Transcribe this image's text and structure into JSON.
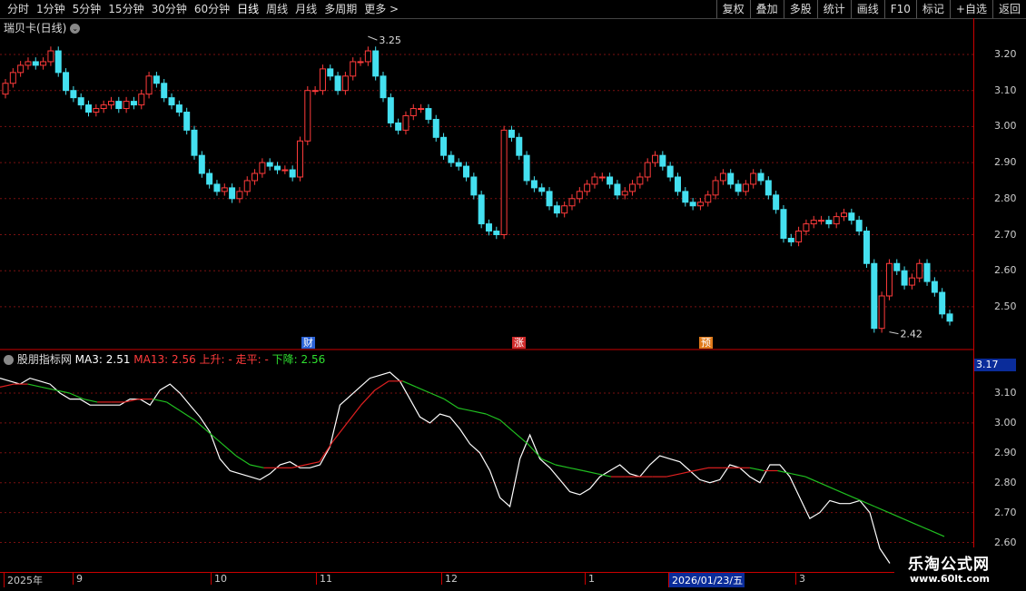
{
  "toolbar": {
    "periods": [
      "分时",
      "1分钟",
      "5分钟",
      "15分钟",
      "30分钟",
      "60分钟",
      "日线",
      "周线",
      "月线",
      "多周期",
      "更多"
    ],
    "active_period": "日线",
    "buttons": [
      "复权",
      "叠加",
      "多股",
      "统计",
      "画线",
      "F10",
      "标记",
      "+自选",
      "返回"
    ]
  },
  "chart_title": "瑞贝卡(日线)",
  "price_axis": {
    "ticks": [
      "3.20",
      "3.10",
      "3.00",
      "2.90",
      "2.80",
      "2.70",
      "2.60",
      "2.50"
    ],
    "range": [
      2.42,
      3.25
    ]
  },
  "annotations": {
    "high": "3.25",
    "low": "2.42"
  },
  "event_tags": [
    {
      "label": "财",
      "color": "#2a62d8"
    },
    {
      "label": "涨",
      "color": "#d02a2a"
    },
    {
      "label": "预",
      "color": "#e07a1a"
    }
  ],
  "indicator": {
    "name": "股朋指标网",
    "ma3_label": "MA3:",
    "ma3_value": "2.51",
    "ma13_label": "MA13:",
    "ma13_value": "2.56",
    "up_label": "上升:",
    "up_value": "-",
    "flat_label": "走平:",
    "flat_value": "-",
    "down_label": "下降:",
    "down_value": "2.56",
    "current": "3.17",
    "axis_ticks": [
      "3.10",
      "3.00",
      "2.90",
      "2.80",
      "2.70",
      "2.60"
    ],
    "range": [
      2.6,
      3.17
    ]
  },
  "time_axis": {
    "labels": [
      "2025年",
      "9",
      "10",
      "11",
      "12",
      "1",
      "2026/01/23/五",
      "3"
    ]
  },
  "watermark": {
    "title": "乐淘公式网",
    "url": "www.60lt.com"
  },
  "colors": {
    "up": "#ff3b3b",
    "down": "#44e0f0",
    "ma3": "#ffffff",
    "ma13_rise": "#e02020",
    "ma13_fall": "#20c020",
    "grid": "#7a1010"
  },
  "chart_data": {
    "type": "candlestick",
    "open": [
      3.09,
      3.12,
      3.15,
      3.17,
      3.18,
      3.17,
      3.18,
      3.21,
      3.15,
      3.1,
      3.08,
      3.06,
      3.04,
      3.05,
      3.06,
      3.07,
      3.05,
      3.07,
      3.06,
      3.09,
      3.14,
      3.12,
      3.08,
      3.06,
      3.04,
      2.99,
      2.92,
      2.87,
      2.84,
      2.82,
      2.83,
      2.8,
      2.82,
      2.85,
      2.87,
      2.9,
      2.89,
      2.88,
      2.88,
      2.86,
      2.96,
      3.1,
      3.1,
      3.16,
      3.14,
      3.1,
      3.14,
      3.18,
      3.18,
      3.21,
      3.14,
      3.08,
      3.01,
      2.99,
      3.03,
      3.05,
      3.05,
      3.02,
      2.97,
      2.92,
      2.9,
      2.89,
      2.86,
      2.81,
      2.73,
      2.71,
      2.7,
      2.99,
      2.97,
      2.92,
      2.85,
      2.83,
      2.82,
      2.78,
      2.76,
      2.78,
      2.8,
      2.82,
      2.84,
      2.86,
      2.86,
      2.84,
      2.81,
      2.82,
      2.84,
      2.86,
      2.9,
      2.92,
      2.89,
      2.86,
      2.82,
      2.79,
      2.78,
      2.79,
      2.81,
      2.85,
      2.87,
      2.84,
      2.82,
      2.84,
      2.87,
      2.85,
      2.81,
      2.77,
      2.69,
      2.68,
      2.71,
      2.73,
      2.74,
      2.74,
      2.73,
      2.75,
      2.76,
      2.74,
      2.71,
      2.62,
      2.44,
      2.53,
      2.62,
      2.6,
      2.56,
      2.58,
      2.62,
      2.57,
      2.54,
      2.48
    ],
    "close": [
      3.12,
      3.15,
      3.17,
      3.18,
      3.17,
      3.18,
      3.21,
      3.15,
      3.1,
      3.08,
      3.06,
      3.04,
      3.05,
      3.06,
      3.07,
      3.05,
      3.07,
      3.06,
      3.09,
      3.14,
      3.12,
      3.08,
      3.06,
      3.04,
      2.99,
      2.92,
      2.87,
      2.84,
      2.82,
      2.83,
      2.8,
      2.82,
      2.85,
      2.87,
      2.9,
      2.89,
      2.88,
      2.88,
      2.86,
      2.96,
      3.1,
      3.1,
      3.16,
      3.14,
      3.1,
      3.14,
      3.18,
      3.18,
      3.21,
      3.14,
      3.08,
      3.01,
      2.99,
      3.03,
      3.05,
      3.05,
      3.02,
      2.97,
      2.92,
      2.9,
      2.89,
      2.86,
      2.81,
      2.73,
      2.71,
      2.7,
      2.99,
      2.97,
      2.92,
      2.85,
      2.83,
      2.82,
      2.78,
      2.76,
      2.78,
      2.8,
      2.82,
      2.84,
      2.86,
      2.86,
      2.84,
      2.81,
      2.82,
      2.84,
      2.86,
      2.9,
      2.92,
      2.89,
      2.86,
      2.82,
      2.79,
      2.78,
      2.79,
      2.81,
      2.85,
      2.87,
      2.84,
      2.82,
      2.84,
      2.87,
      2.85,
      2.81,
      2.77,
      2.69,
      2.68,
      2.71,
      2.73,
      2.74,
      2.74,
      2.73,
      2.75,
      2.76,
      2.74,
      2.71,
      2.62,
      2.44,
      2.53,
      2.62,
      2.6,
      2.56,
      2.58,
      2.62,
      2.57,
      2.54,
      2.48,
      2.46
    ],
    "ma3": [
      3.15,
      3.14,
      3.13,
      3.15,
      3.14,
      3.13,
      3.1,
      3.08,
      3.08,
      3.06,
      3.06,
      3.06,
      3.06,
      3.08,
      3.08,
      3.06,
      3.11,
      3.13,
      3.1,
      3.06,
      3.02,
      2.97,
      2.88,
      2.84,
      2.83,
      2.82,
      2.81,
      2.83,
      2.86,
      2.87,
      2.85,
      2.85,
      2.86,
      2.92,
      3.06,
      3.09,
      3.12,
      3.15,
      3.16,
      3.17,
      3.14,
      3.08,
      3.02,
      3.0,
      3.03,
      3.02,
      2.98,
      2.93,
      2.9,
      2.84,
      2.75,
      2.72,
      2.88,
      2.96,
      2.88,
      2.85,
      2.81,
      2.77,
      2.76,
      2.78,
      2.82,
      2.84,
      2.86,
      2.83,
      2.82,
      2.86,
      2.89,
      2.88,
      2.87,
      2.84,
      2.81,
      2.8,
      2.81,
      2.86,
      2.85,
      2.82,
      2.8,
      2.86,
      2.86,
      2.82,
      2.75,
      2.68,
      2.7,
      2.74,
      2.73,
      2.73,
      2.74,
      2.7,
      2.58,
      2.53
    ],
    "ma13": [
      3.12,
      3.13,
      3.13,
      3.12,
      3.11,
      3.1,
      3.08,
      3.07,
      3.07,
      3.07,
      3.08,
      3.08,
      3.07,
      3.04,
      3.01,
      2.97,
      2.93,
      2.89,
      2.86,
      2.85,
      2.85,
      2.85,
      2.86,
      2.87,
      2.94,
      3.0,
      3.06,
      3.11,
      3.14,
      3.14,
      3.12,
      3.1,
      3.08,
      3.05,
      3.04,
      3.03,
      3.01,
      2.97,
      2.93,
      2.88,
      2.86,
      2.85,
      2.84,
      2.83,
      2.82,
      2.82,
      2.82,
      2.82,
      2.82,
      2.83,
      2.84,
      2.85,
      2.85,
      2.85,
      2.85,
      2.84,
      2.84,
      2.83,
      2.82,
      2.8,
      2.78,
      2.76,
      2.74,
      2.72,
      2.7,
      2.68,
      2.66,
      2.64,
      2.62
    ]
  }
}
